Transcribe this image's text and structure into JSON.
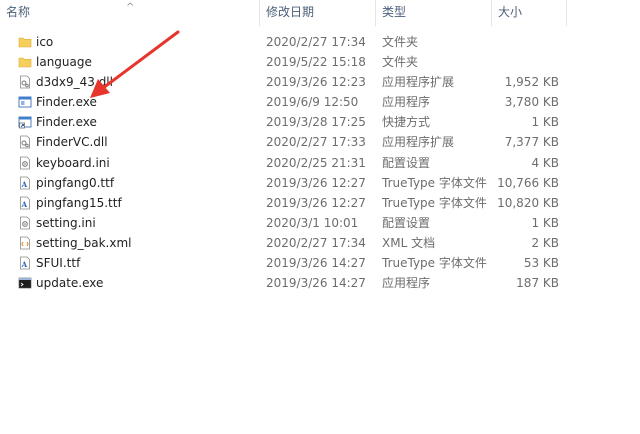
{
  "header": {
    "name": "名称",
    "date": "修改日期",
    "type": "类型",
    "size": "大小",
    "sort_indicator": "^"
  },
  "files": [
    {
      "name": "ico",
      "date": "2020/2/27 17:34",
      "type": "文件夹",
      "size": "",
      "icon": "folder-icon"
    },
    {
      "name": "language",
      "date": "2019/5/22 15:18",
      "type": "文件夹",
      "size": "",
      "icon": "folder-icon"
    },
    {
      "name": "d3dx9_43.dll",
      "date": "2019/3/26 12:23",
      "type": "应用程序扩展",
      "size": "1,952 KB",
      "icon": "dll-icon"
    },
    {
      "name": "Finder.exe",
      "date": "2019/6/9 12:50",
      "type": "应用程序",
      "size": "3,780 KB",
      "icon": "exe-icon"
    },
    {
      "name": "Finder.exe",
      "date": "2019/3/28 17:25",
      "type": "快捷方式",
      "size": "1 KB",
      "icon": "shortcut-icon"
    },
    {
      "name": "FinderVC.dll",
      "date": "2020/2/27 17:33",
      "type": "应用程序扩展",
      "size": "7,377 KB",
      "icon": "dll-icon"
    },
    {
      "name": "keyboard.ini",
      "date": "2020/2/25 21:31",
      "type": "配置设置",
      "size": "4 KB",
      "icon": "ini-icon"
    },
    {
      "name": "pingfang0.ttf",
      "date": "2019/3/26 12:27",
      "type": "TrueType 字体文件",
      "size": "10,766 KB",
      "icon": "font-icon"
    },
    {
      "name": "pingfang15.ttf",
      "date": "2019/3/26 12:27",
      "type": "TrueType 字体文件",
      "size": "10,820 KB",
      "icon": "font-icon"
    },
    {
      "name": "setting.ini",
      "date": "2020/3/1 10:01",
      "type": "配置设置",
      "size": "1 KB",
      "icon": "ini-icon"
    },
    {
      "name": "setting_bak.xml",
      "date": "2020/2/27 17:34",
      "type": "XML 文档",
      "size": "2 KB",
      "icon": "xml-icon"
    },
    {
      "name": "SFUI.ttf",
      "date": "2019/3/26 14:27",
      "type": "TrueType 字体文件",
      "size": "53 KB",
      "icon": "font-icon"
    },
    {
      "name": "update.exe",
      "date": "2019/3/26 14:27",
      "type": "应用程序",
      "size": "187 KB",
      "icon": "console-exe-icon"
    }
  ],
  "colors": {
    "folder": "#f6cf5d",
    "arrow": "#e8352b",
    "header_text": "#4c607a"
  }
}
